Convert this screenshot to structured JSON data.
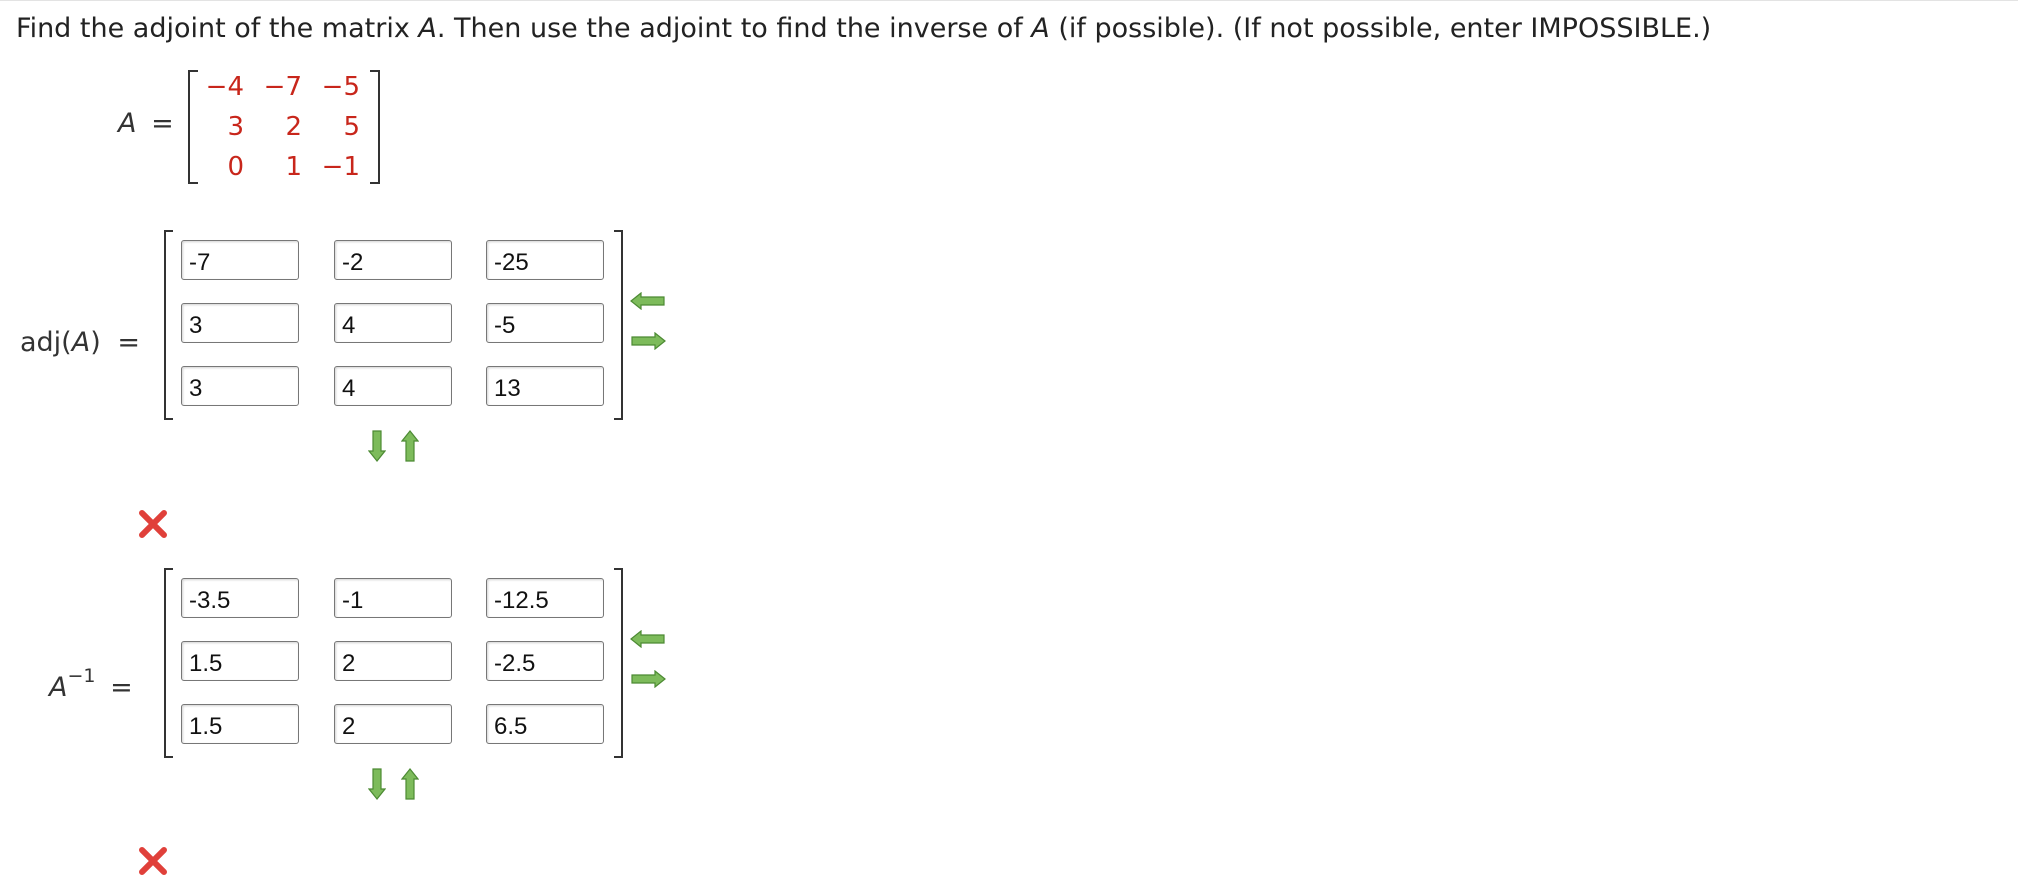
{
  "question": {
    "part1": "Find the adjoint of the matrix ",
    "var1": "A",
    "part2": ". Then use the adjoint to find the inverse of ",
    "var2": "A",
    "part3": " (if possible). (If not possible, enter IMPOSSIBLE.)"
  },
  "matrix_a": {
    "label_var": "A",
    "label_eq": "=",
    "rows": [
      [
        "−4",
        "−7",
        "−5"
      ],
      [
        "3",
        "2",
        "5"
      ],
      [
        "0",
        "1",
        "−1"
      ]
    ]
  },
  "adj": {
    "label_pre": "adj(",
    "label_var": "A",
    "label_post": ")",
    "label_eq": "=",
    "values": [
      [
        "-7",
        "-2",
        "-25"
      ],
      [
        "3",
        "4",
        "-5"
      ],
      [
        "3",
        "4",
        "13"
      ]
    ],
    "status": "incorrect"
  },
  "inverse": {
    "label_var": "A",
    "label_sup": "−1",
    "label_eq": "=",
    "values": [
      [
        "-3.5",
        "-1",
        "-12.5"
      ],
      [
        "1.5",
        "2",
        "-2.5"
      ],
      [
        "1.5",
        "2",
        "6.5"
      ]
    ],
    "status": "incorrect"
  },
  "colors": {
    "given_entries": "#c8261b",
    "arrow_fill": "#7dbb5b",
    "arrow_stroke": "#4c8a33",
    "x_mark": "#e0403a"
  },
  "icons": [
    "remove-column-icon",
    "add-column-icon",
    "add-row-icon",
    "remove-row-icon",
    "incorrect-x-icon"
  ]
}
